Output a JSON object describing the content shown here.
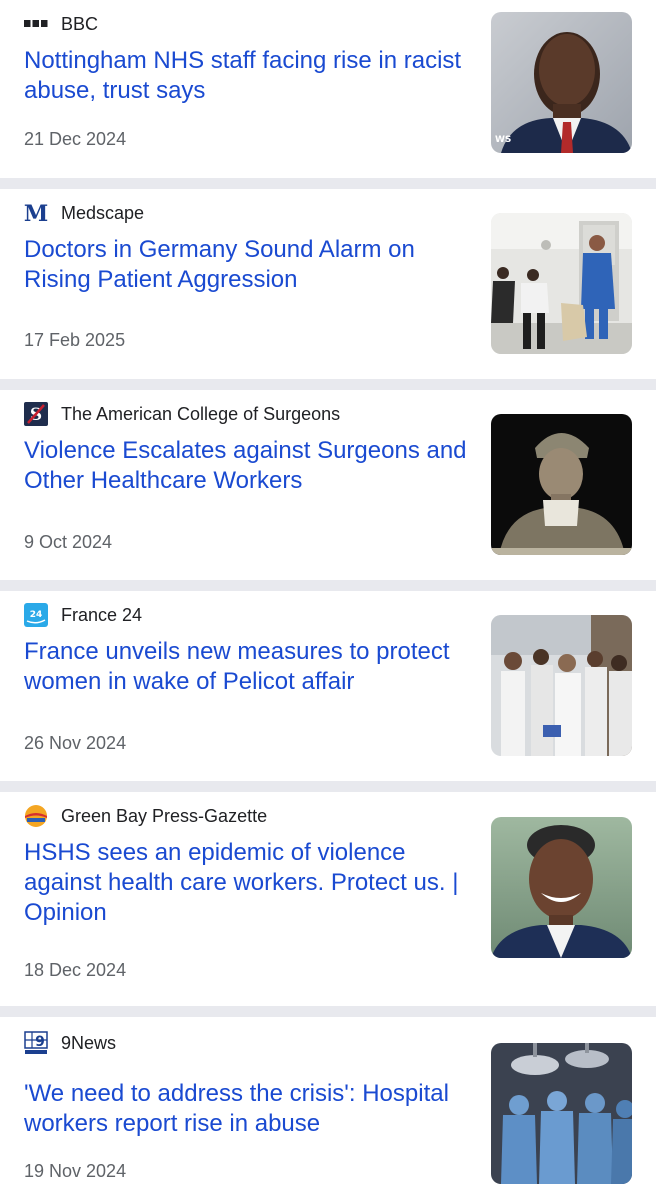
{
  "articles": [
    {
      "source": "BBC",
      "logo": "bbc-logo",
      "headline": "Nottingham NHS staff facing rise in racist abuse, trust says",
      "date": "21 Dec 2024",
      "image": "man-in-suit-photo",
      "image_watermark": "WS"
    },
    {
      "source": "Medscape",
      "logo": "medscape-logo",
      "logo_text": "M",
      "headline": "Doctors in Germany Sound Alarm on Rising Patient Aggression",
      "date": "17 Feb 2025",
      "image": "hospital-corridor-photo"
    },
    {
      "source": "The American College of Surgeons",
      "logo": "acs-logo",
      "logo_text": "S",
      "headline": "Violence Escalates against Surgeons and Other Healthcare Workers",
      "date": "9 Oct 2024",
      "image": "surgeon-portrait-photo"
    },
    {
      "source": "France 24",
      "logo": "france24-logo",
      "logo_text": "24",
      "headline": "France unveils new measures to protect women in wake of Pelicot affair",
      "date": "26 Nov 2024",
      "image": "medical-staff-crowd-photo"
    },
    {
      "source": "Green Bay Press-Gazette",
      "logo": "press-gazette-logo",
      "headline": "HSHS sees an epidemic of violence against health care workers. Protect us. | Opinion",
      "date": "18 Dec 2024",
      "image": "smiling-man-photo"
    },
    {
      "source": "9News",
      "logo": "9news-logo",
      "logo_text": "9",
      "headline": "'We need to address the crisis': Hospital workers report rise in abuse",
      "date": "19 Nov 2024",
      "image": "operating-room-photo"
    }
  ],
  "colors": {
    "headline": "#1a4ad1",
    "source": "#202124",
    "date": "#5f6368",
    "divider": "#e8e9ee"
  }
}
